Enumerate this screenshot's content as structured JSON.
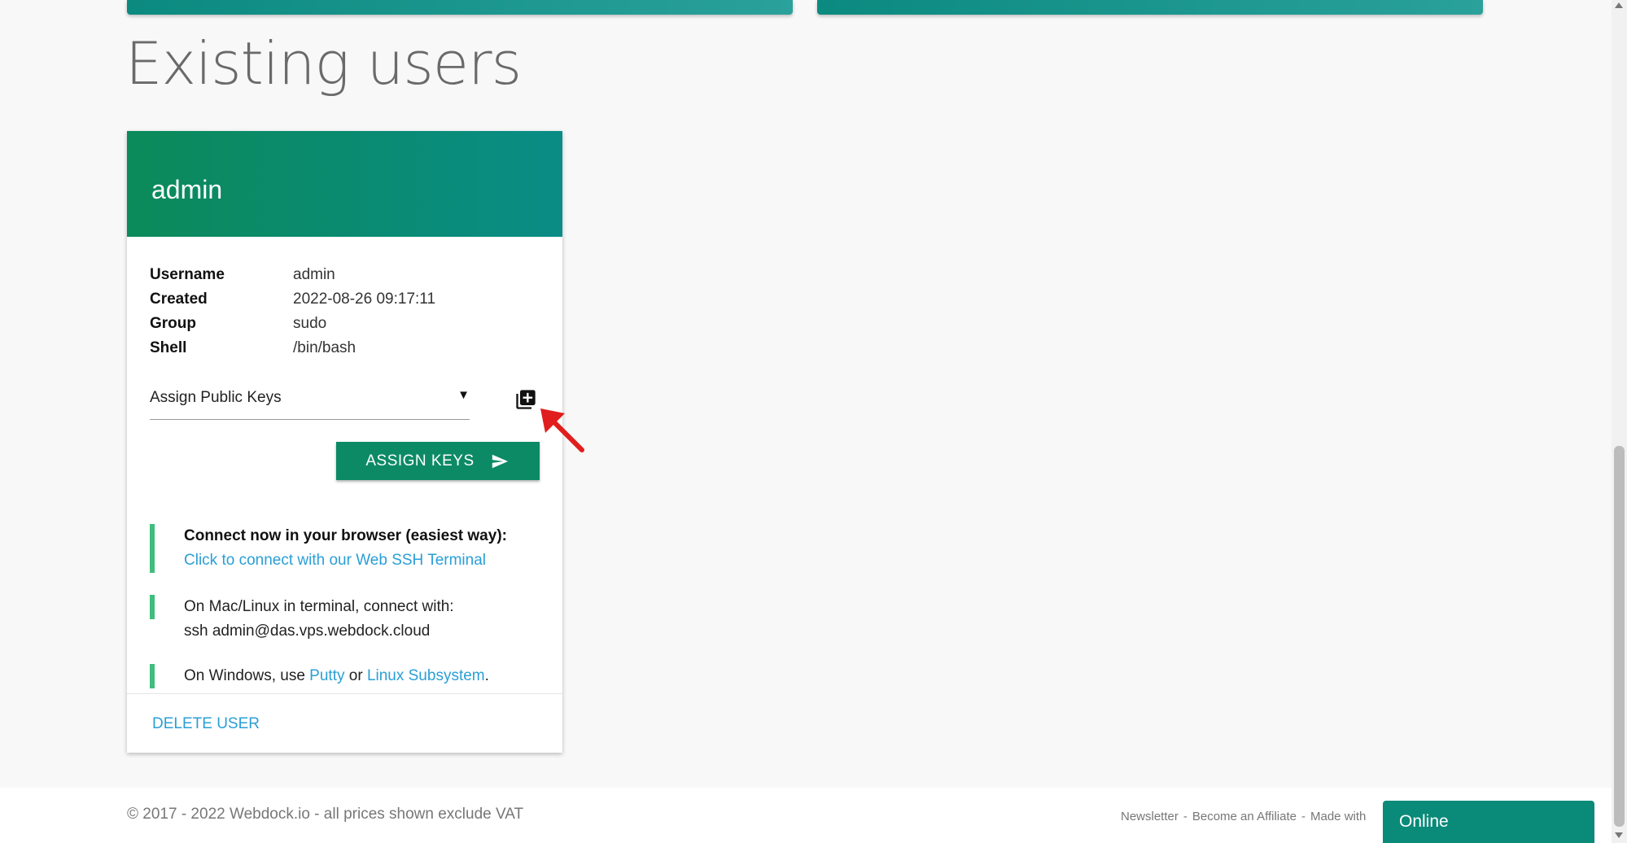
{
  "page_title": "Existing users",
  "user_card": {
    "title": "admin",
    "info": [
      {
        "label": "Username",
        "value": "admin"
      },
      {
        "label": "Created",
        "value": "2022-08-26 09:17:11"
      },
      {
        "label": "Group",
        "value": "sudo"
      },
      {
        "label": "Shell",
        "value": "/bin/bash"
      }
    ],
    "assign_select_label": "Assign Public Keys",
    "assign_button_label": "ASSIGN KEYS",
    "connect_browser_heading": "Connect now in your browser (easiest way):",
    "connect_browser_link": "Click to connect with our Web SSH Terminal",
    "connect_mac_line1": "On Mac/Linux in terminal, connect with:",
    "connect_mac_line2": "ssh admin@das.vps.webdock.cloud",
    "connect_windows_prefix": "On Windows, use ",
    "connect_windows_putty": "Putty",
    "connect_windows_or": " or ",
    "connect_windows_subsystem": "Linux Subsystem",
    "connect_windows_suffix": ".",
    "delete_label": "DELETE USER"
  },
  "footer": {
    "copyright": "© 2017 - 2022 Webdock.io - all prices shown exclude VAT",
    "links": [
      "Newsletter",
      "Become an Affiliate",
      "Made with"
    ],
    "separator": "-"
  },
  "chat_widget": {
    "label": "Online"
  },
  "colors": {
    "brand_teal": "#0a8c86",
    "brand_green": "#0c8a66",
    "link_blue": "#2a9fd6",
    "connect_bar_green": "#3fbe7c",
    "annotation_red": "#e01e1e"
  },
  "icons": {
    "add_key": "library-add-icon",
    "send": "send-icon",
    "annotation": "red-arrow-icon"
  }
}
